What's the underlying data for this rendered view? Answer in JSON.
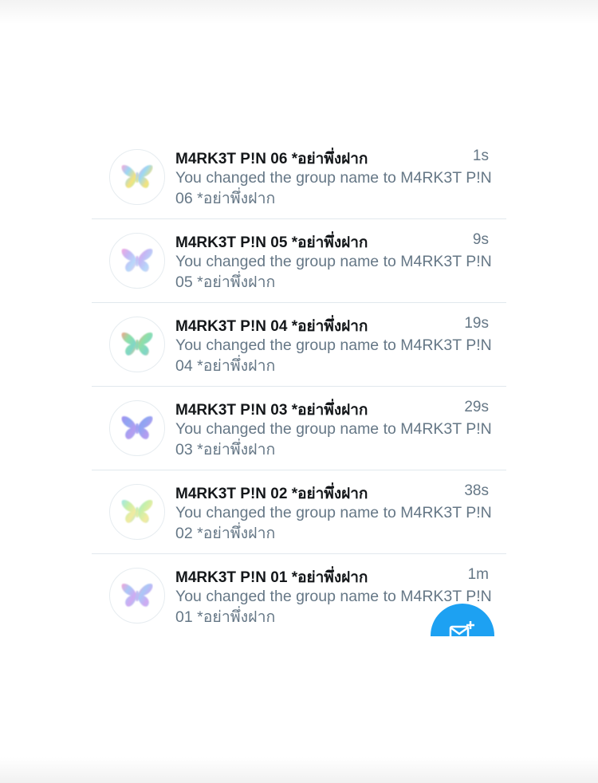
{
  "conversations": [
    {
      "title": "M4RK3T P!N 06 *อย่าพึ่งฝาก",
      "time": "1s",
      "preview": "You changed the group name to M4RK3T P!N 06 *อย่าพึ่งฝาก",
      "avatar_icon": "butterfly-icon",
      "avatar_colors": [
        "#f7a8d8",
        "#9ad8f5",
        "#f6e27a",
        "#a8f0c0"
      ]
    },
    {
      "title": "M4RK3T P!N 05 *อย่าพึ่งฝาก",
      "time": "9s",
      "preview": "You changed the group name to M4RK3T P!N 05 *อย่าพึ่งฝาก",
      "avatar_icon": "butterfly-icon",
      "avatar_colors": [
        "#f2a6e0",
        "#c3b8f5",
        "#b7d8fa",
        "#f5c6e6"
      ]
    },
    {
      "title": "M4RK3T P!N 04 *อย่าพึ่งฝาก",
      "time": "19s",
      "preview": "You changed the group name to M4RK3T P!N 04 *อย่าพึ่งฝาก",
      "avatar_icon": "butterfly-icon",
      "avatar_colors": [
        "#f4a38a",
        "#8fe0a8",
        "#7fd6c8",
        "#f3c68f"
      ]
    },
    {
      "title": "M4RK3T P!N 03 *อย่าพึ่งฝาก",
      "time": "29s",
      "preview": "You changed the group name to M4RK3T P!N 03 *อย่าพึ่งฝาก",
      "avatar_icon": "butterfly-icon",
      "avatar_colors": [
        "#a58ff0",
        "#8fa6f2",
        "#b59cf0",
        "#9ab2f4"
      ]
    },
    {
      "title": "M4RK3T P!N 02 *อย่าพึ่งฝาก",
      "time": "38s",
      "preview": "You changed the group name to M4RK3T P!N 02 *อย่าพึ่งฝาก",
      "avatar_icon": "butterfly-icon",
      "avatar_colors": [
        "#9fe6e8",
        "#c8f0a8",
        "#f3eaa0",
        "#a8e8d8"
      ]
    },
    {
      "title": "M4RK3T P!N 01 *อย่าพึ่งฝาก",
      "time": "1m",
      "preview": "You changed the group name to M4RK3T P!N 01 *อย่าพึ่งฝาก",
      "avatar_icon": "butterfly-icon",
      "avatar_colors": [
        "#f3a2d6",
        "#a9c8f7",
        "#d0a9f2",
        "#9fd6f2"
      ]
    }
  ],
  "compose": {
    "icon": "new-message-icon",
    "color": "#1da1f2"
  }
}
